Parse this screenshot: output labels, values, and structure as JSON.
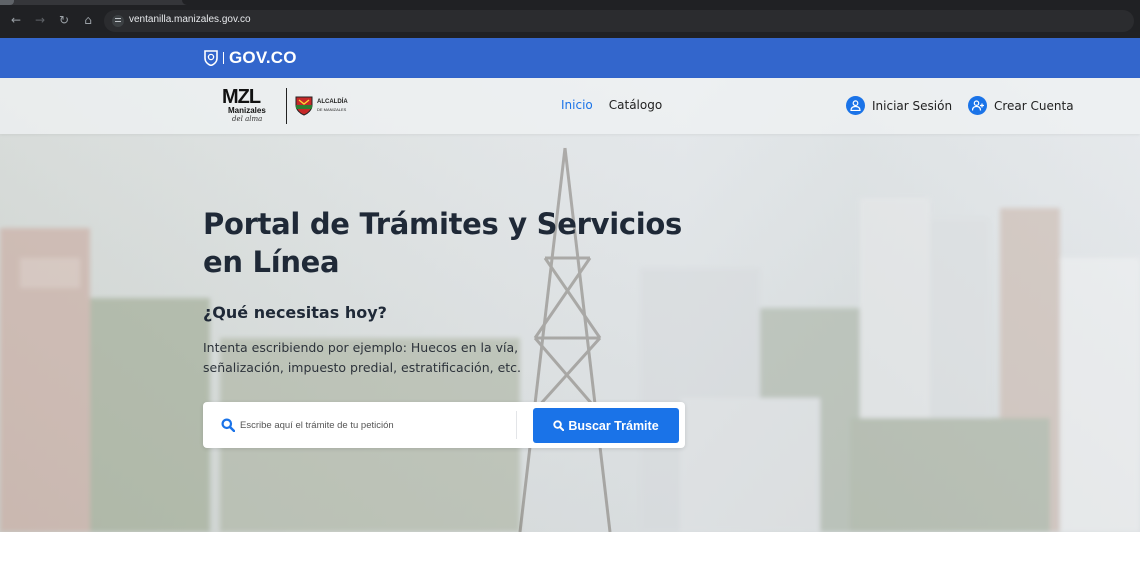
{
  "browser": {
    "url": "ventanilla.manizales.gov.co",
    "back_icon": "arrow-left-icon",
    "forward_icon": "arrow-right-icon",
    "reload_icon": "reload-icon",
    "home_icon": "home-icon"
  },
  "gov_bar": {
    "logo_text": "GOV.CO",
    "color": "#3366cc"
  },
  "header": {
    "brand": {
      "mzl_text": "MZL",
      "mzl_subtitle": "Manizales",
      "mzl_tagline": "del alma",
      "alcaldia_line1": "ALCALDÍA",
      "alcaldia_line2": "DE MANIZALES"
    },
    "nav": [
      {
        "label": "Inicio",
        "active": true
      },
      {
        "label": "Catálogo",
        "active": false
      }
    ],
    "login_label": "Iniciar Sesión",
    "register_label": "Crear Cuenta",
    "accent_color": "#1a73e8"
  },
  "hero": {
    "title": "Portal de Trámites y Servicios en Línea",
    "subtitle": "¿Qué necesitas hoy?",
    "description": "Intenta escribiendo por ejemplo: Huecos en la vía, señalización, impuesto predial, estratificación, etc.",
    "search": {
      "value": "",
      "placeholder": "Escribe aquí el trámite de tu petición",
      "button_label": "Buscar Trámite"
    }
  }
}
